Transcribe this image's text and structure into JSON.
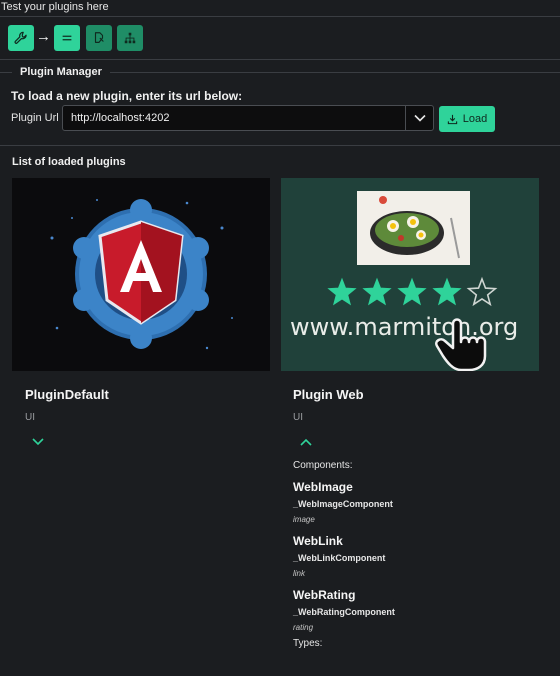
{
  "header": {
    "title": "Test your plugins here"
  },
  "toolbar": {
    "buttons": [
      {
        "icon": "wrench-icon"
      },
      {
        "icon": "equals-icon"
      },
      {
        "icon": "plug-icon"
      },
      {
        "icon": "sitemap-icon"
      }
    ],
    "arrow": "→"
  },
  "plugin_manager": {
    "legend": "Plugin Manager",
    "instruction": "To load a new plugin, enter its url below:",
    "url_label": "Plugin Url",
    "url_value": "http://localhost:4202",
    "load_label": "Load"
  },
  "plugins": {
    "title": "List of loaded plugins",
    "items": [
      {
        "name": "PluginDefault",
        "type": "UI",
        "expanded": false
      },
      {
        "name": "Plugin Web",
        "type": "UI",
        "expanded": true,
        "components_label": "Components:",
        "components": [
          {
            "name": "WebImage",
            "class": "_WebImageComponent",
            "tag": "image"
          },
          {
            "name": "WebLink",
            "class": "_WebLinkComponent",
            "tag": "link"
          },
          {
            "name": "WebRating",
            "class": "_WebRatingComponent",
            "tag": "rating"
          }
        ],
        "types_label": "Types:",
        "image_text": "www.marmiton.org",
        "rating": 4,
        "rating_max": 5
      }
    ]
  },
  "colors": {
    "accent": "#2fd39a",
    "accent_dark": "#1f8d66",
    "background": "#1b1d20"
  }
}
